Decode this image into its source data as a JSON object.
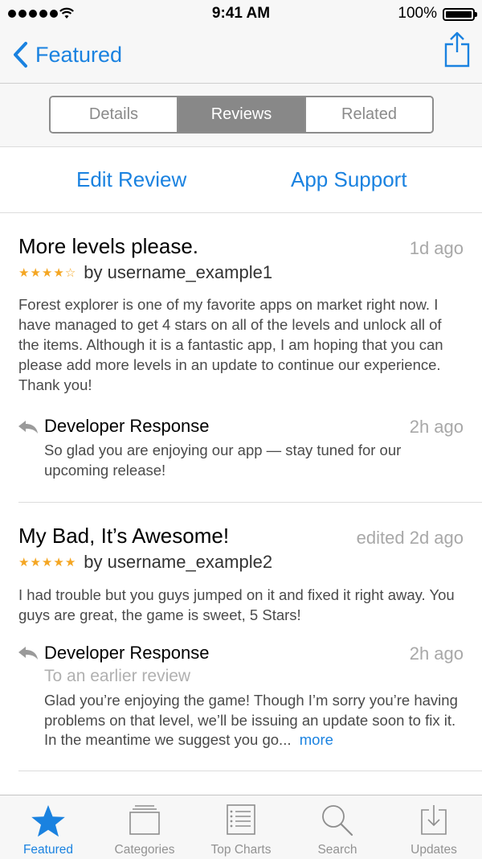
{
  "status_bar": {
    "time": "9:41 AM",
    "battery": "100%"
  },
  "nav": {
    "back_label": "Featured"
  },
  "segments": [
    {
      "label": "Details",
      "active": false
    },
    {
      "label": "Reviews",
      "active": true
    },
    {
      "label": "Related",
      "active": false
    }
  ],
  "actions": {
    "edit_review": "Edit Review",
    "app_support": "App Support"
  },
  "reviews": [
    {
      "title": "More levels please.",
      "time": "1d ago",
      "rating": 4,
      "author": "by username_example1",
      "body": "Forest explorer is one of my favorite apps on market right now. I have managed to get 4 stars on all of the levels and unlock all of the items. Although it is a fantastic app, I am hoping that you can please add more levels in an update to continue our experience. Thank you!",
      "developer_response": {
        "title": "Developer Response",
        "time": "2h ago",
        "body": "So glad you are enjoying our app — stay tuned for our upcoming release!"
      }
    },
    {
      "title": "My Bad, It’s Awesome!",
      "time": "edited 2d ago",
      "rating": 5,
      "author": "by username_example2",
      "body": "I had trouble but you guys jumped on it and fixed it right away. You guys are great, the game is sweet, 5 Stars!",
      "developer_response": {
        "title": "Developer Response",
        "time": "2h ago",
        "subtitle": "To an earlier review",
        "body": "Glad you’re enjoying the game! Though I’m sorry you’re having problems on that level, we’ll be issuing an update soon to fix it. In the meantime we suggest you go...",
        "more_label": "more"
      }
    }
  ],
  "tabs": [
    {
      "label": "Featured",
      "icon": "star-icon",
      "active": true
    },
    {
      "label": "Categories",
      "icon": "categories-icon",
      "active": false
    },
    {
      "label": "Top Charts",
      "icon": "top-charts-icon",
      "active": false
    },
    {
      "label": "Search",
      "icon": "search-icon",
      "active": false
    },
    {
      "label": "Updates",
      "icon": "updates-icon",
      "active": false
    }
  ],
  "colors": {
    "accent": "#1a82e0",
    "star": "#f4a623",
    "muted": "#a8a8a8"
  }
}
